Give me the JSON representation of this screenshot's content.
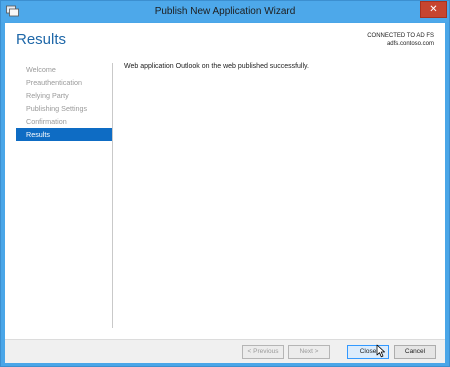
{
  "window": {
    "title": "Publish New Application Wizard",
    "close_glyph": "✕"
  },
  "header": {
    "page_title": "Results",
    "connection_line1": "CONNECTED TO AD FS",
    "connection_line2": "adfs.contoso.com"
  },
  "steps": [
    {
      "label": "Welcome",
      "active": false
    },
    {
      "label": "Preauthentication",
      "active": false
    },
    {
      "label": "Relying Party",
      "active": false
    },
    {
      "label": "Publishing Settings",
      "active": false
    },
    {
      "label": "Confirmation",
      "active": false
    },
    {
      "label": "Results",
      "active": true
    }
  ],
  "content": {
    "message": "Web application Outlook on the web published successfully."
  },
  "buttons": {
    "previous": "< Previous",
    "next": "Next >",
    "close": "Close",
    "cancel": "Cancel"
  },
  "colors": {
    "title_bar": "#4da8ea",
    "accent": "#0e6cc4",
    "close_button": "#c7452f"
  }
}
